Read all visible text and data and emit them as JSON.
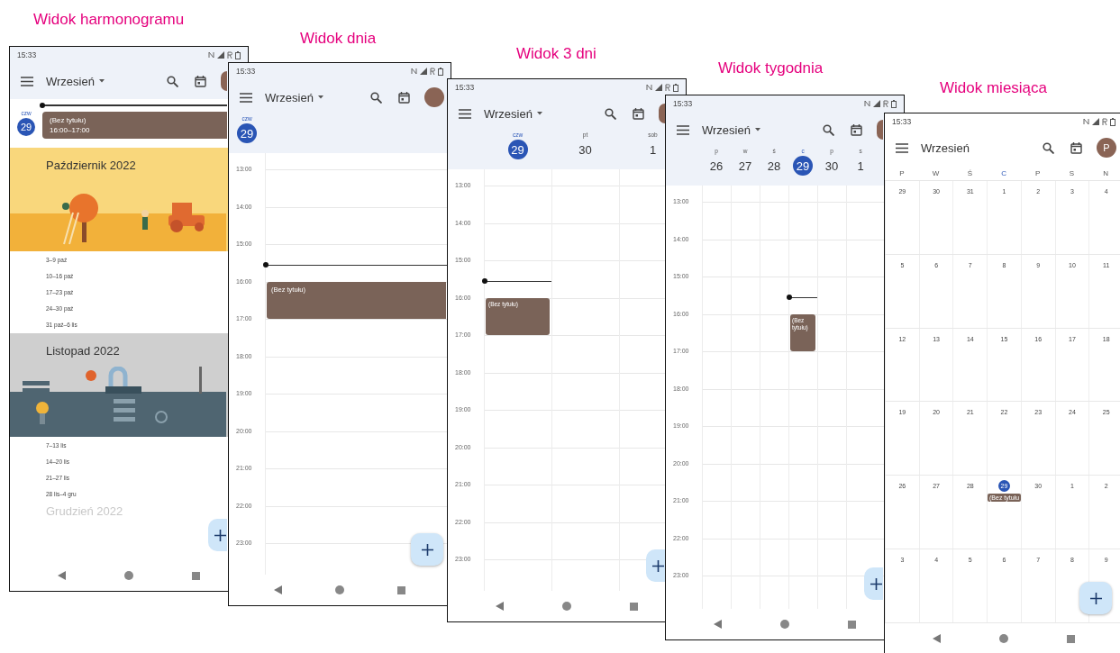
{
  "views": [
    {
      "kind": "schedule",
      "caption": "Widok harmonogramu",
      "time": "15:33",
      "title": "Wrzesień",
      "dropdown": true,
      "today": {
        "weekday": "czw",
        "day": "29"
      },
      "events": [
        {
          "title": "(Bez tytułu)",
          "time": "16:00–17:00"
        }
      ],
      "months": [
        {
          "name": "Październik 2022",
          "kind": "autumn",
          "weeks": [
            "3–9 paź",
            "10–16 paź",
            "17–23 paź",
            "24–30 paź",
            "31 paź–6 lis"
          ]
        },
        {
          "name": "Listopad 2022",
          "kind": "winter",
          "weeks": [
            "7–13 lis",
            "14–20 lis",
            "21–27 lis",
            "28 lis–4 gru"
          ]
        }
      ],
      "next_month": "Grudzień 2022"
    },
    {
      "kind": "day",
      "caption": "Widok dnia",
      "time": "15:33",
      "title": "Wrzesień",
      "dropdown": true,
      "days": [
        {
          "weekday": "czw",
          "day": "29",
          "selected": true,
          "events": [
            {
              "title": "(Bez tytułu)"
            }
          ]
        }
      ],
      "hours": [
        "13:00",
        "14:00",
        "15:00",
        "16:00",
        "17:00",
        "18:00",
        "19:00",
        "20:00",
        "21:00",
        "22:00",
        "23:00"
      ]
    },
    {
      "kind": "three_day",
      "caption": "Widok 3 dni",
      "time": "15:33",
      "title": "Wrzesień",
      "dropdown": true,
      "days": [
        {
          "weekday": "czw",
          "day": "29",
          "selected": true,
          "events": [
            {
              "title": "(Bez tytułu)"
            }
          ]
        },
        {
          "weekday": "pt",
          "day": "30",
          "selected": false
        },
        {
          "weekday": "sob",
          "day": "1",
          "selected": false
        }
      ],
      "hours": [
        "13:00",
        "14:00",
        "15:00",
        "16:00",
        "17:00",
        "18:00",
        "19:00",
        "20:00",
        "21:00",
        "22:00",
        "23:00"
      ]
    },
    {
      "kind": "week",
      "caption": "Widok tygodnia",
      "time": "15:33",
      "title": "Wrzesień",
      "dropdown": true,
      "days": [
        {
          "weekday": "p",
          "day": "26",
          "selected": false
        },
        {
          "weekday": "w",
          "day": "27",
          "selected": false
        },
        {
          "weekday": "ś",
          "day": "28",
          "selected": false
        },
        {
          "weekday": "c",
          "day": "29",
          "selected": true,
          "events": [
            {
              "title": "(Bez tytułu)"
            }
          ]
        },
        {
          "weekday": "p",
          "day": "30",
          "selected": false
        },
        {
          "weekday": "s",
          "day": "1",
          "selected": false
        }
      ],
      "hours": [
        "13:00",
        "14:00",
        "15:00",
        "16:00",
        "17:00",
        "18:00",
        "19:00",
        "20:00",
        "21:00",
        "22:00",
        "23:00"
      ]
    },
    {
      "kind": "month",
      "caption": "Widok miesiąca",
      "time": "15:33",
      "title": "Wrzesień",
      "dropdown": false,
      "avatar": "P",
      "weekdays": [
        {
          "label": "P",
          "selected": false
        },
        {
          "label": "W",
          "selected": false
        },
        {
          "label": "Ś",
          "selected": false
        },
        {
          "label": "C",
          "selected": true
        },
        {
          "label": "P",
          "selected": false
        },
        {
          "label": "S",
          "selected": false
        },
        {
          "label": "N",
          "selected": false
        }
      ],
      "weeks": [
        [
          {
            "day": "29",
            "selected": false
          },
          {
            "day": "30",
            "selected": false
          },
          {
            "day": "31",
            "selected": false
          },
          {
            "day": "1",
            "selected": false
          },
          {
            "day": "2",
            "selected": false
          },
          {
            "day": "3",
            "selected": false
          },
          {
            "day": "4",
            "selected": false
          }
        ],
        [
          {
            "day": "5",
            "selected": false
          },
          {
            "day": "6",
            "selected": false
          },
          {
            "day": "7",
            "selected": false
          },
          {
            "day": "8",
            "selected": false
          },
          {
            "day": "9",
            "selected": false
          },
          {
            "day": "10",
            "selected": false
          },
          {
            "day": "11",
            "selected": false
          }
        ],
        [
          {
            "day": "12",
            "selected": false
          },
          {
            "day": "13",
            "selected": false
          },
          {
            "day": "14",
            "selected": false
          },
          {
            "day": "15",
            "selected": false
          },
          {
            "day": "16",
            "selected": false
          },
          {
            "day": "17",
            "selected": false
          },
          {
            "day": "18",
            "selected": false
          }
        ],
        [
          {
            "day": "19",
            "selected": false
          },
          {
            "day": "20",
            "selected": false
          },
          {
            "day": "21",
            "selected": false
          },
          {
            "day": "22",
            "selected": false
          },
          {
            "day": "23",
            "selected": false
          },
          {
            "day": "24",
            "selected": false
          },
          {
            "day": "25",
            "selected": false
          }
        ],
        [
          {
            "day": "26",
            "selected": false
          },
          {
            "day": "27",
            "selected": false
          },
          {
            "day": "28",
            "selected": false
          },
          {
            "day": "29",
            "selected": true,
            "events": [
              {
                "title": "(Bez tytułu"
              }
            ]
          },
          {
            "day": "30",
            "selected": false
          },
          {
            "day": "1",
            "selected": false
          },
          {
            "day": "2",
            "selected": false
          }
        ],
        [
          {
            "day": "3",
            "selected": false
          },
          {
            "day": "4",
            "selected": false
          },
          {
            "day": "5",
            "selected": false
          },
          {
            "day": "6",
            "selected": false
          },
          {
            "day": "7",
            "selected": false
          },
          {
            "day": "8",
            "selected": false
          },
          {
            "day": "9",
            "selected": false
          }
        ]
      ]
    }
  ]
}
